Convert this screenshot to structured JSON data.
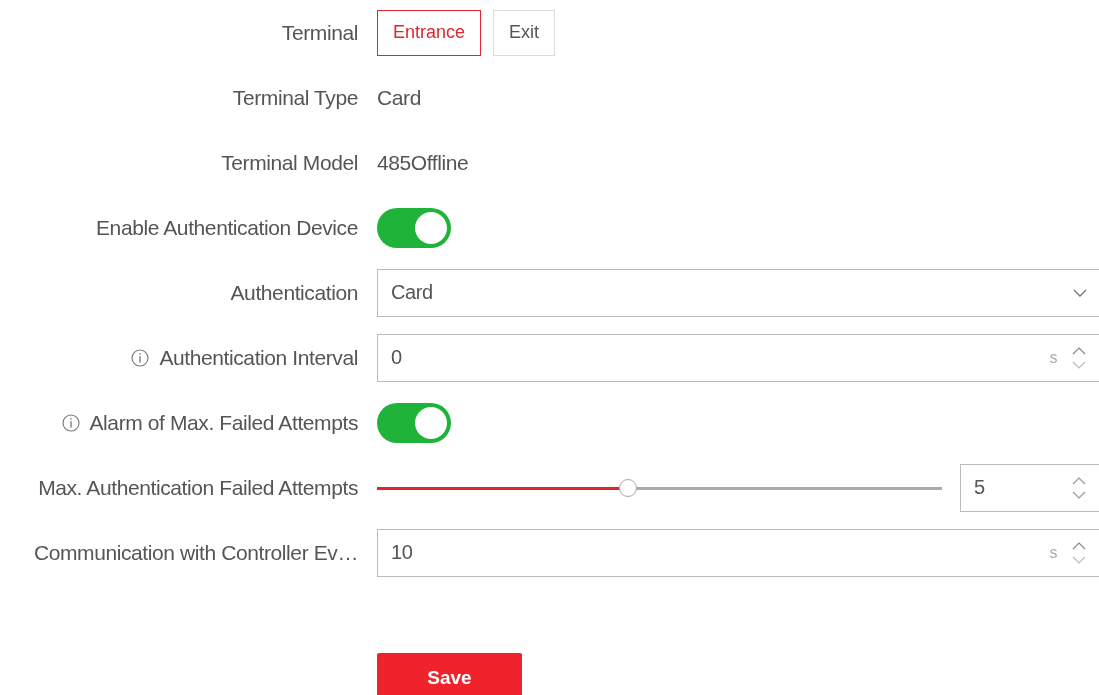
{
  "form": {
    "rows": [
      {
        "kind": "buttons",
        "label": "Terminal",
        "info": false,
        "options": [
          {
            "label": "Entrance",
            "selected": true
          },
          {
            "label": "Exit",
            "selected": false
          }
        ]
      },
      {
        "kind": "text",
        "label": "Terminal Type",
        "info": false,
        "value": "Card"
      },
      {
        "kind": "text",
        "label": "Terminal Model",
        "info": false,
        "value": "485Offline"
      },
      {
        "kind": "toggle",
        "label": "Enable Authentication Device",
        "info": false,
        "on": true
      },
      {
        "kind": "select",
        "label": "Authentication",
        "info": false,
        "value": "Card"
      },
      {
        "kind": "number",
        "label": "Authentication Interval",
        "info": true,
        "value": "0",
        "unit": "s"
      },
      {
        "kind": "toggle",
        "label": "Alarm of Max. Failed Attempts",
        "info": true,
        "on": true
      },
      {
        "kind": "slider",
        "label": "Max. Authentication Failed Attempts",
        "info": false,
        "level": 0.444,
        "value": "5"
      },
      {
        "kind": "number",
        "label": "Communication with Controller Ev…",
        "info": false,
        "value": "10",
        "unit": "s"
      }
    ]
  },
  "save_button": "Save"
}
